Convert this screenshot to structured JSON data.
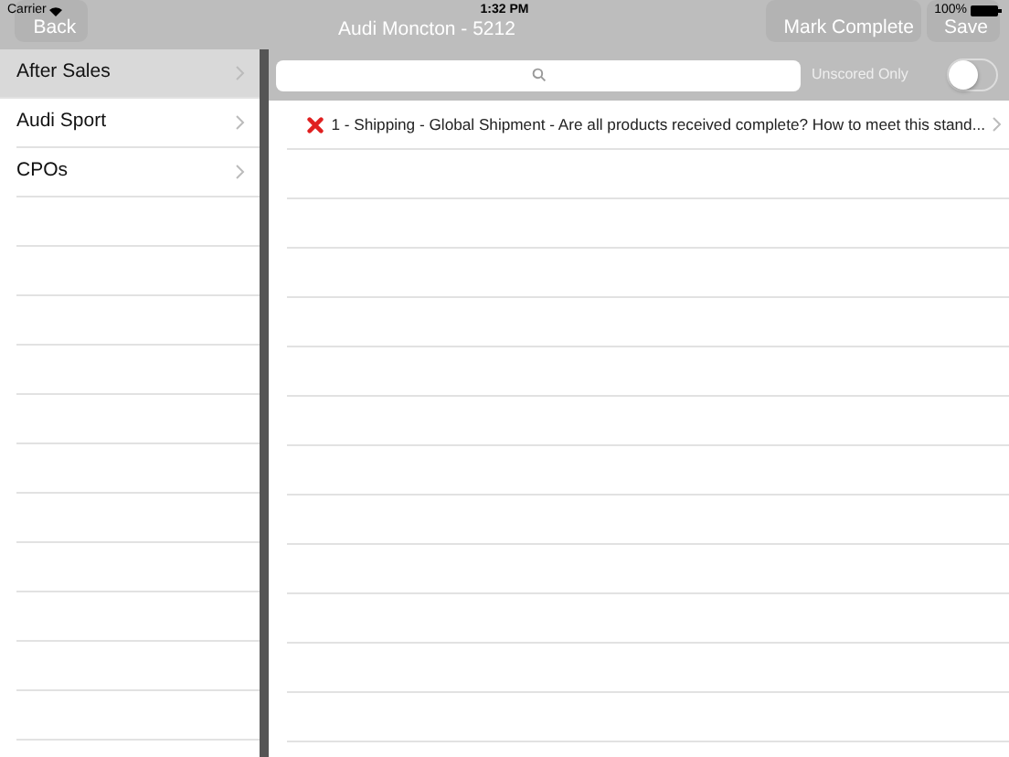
{
  "status_bar": {
    "carrier": "Carrier",
    "time": "1:32 PM",
    "battery": "100%"
  },
  "nav_bar": {
    "back": "Back",
    "title": "Audi Moncton - 5212",
    "buttons": [
      "Mark Complete",
      "Save"
    ]
  },
  "sidebar": {
    "items": [
      {
        "label": "After Sales",
        "selected": true
      },
      {
        "label": "Audi Sport",
        "selected": false
      },
      {
        "label": "CPOs",
        "selected": false
      }
    ]
  },
  "filter": {
    "unscored_only_label": "Unscored Only",
    "unscored_only": false
  },
  "questions": [
    {
      "label": "1 - Shipping - Global Shipment - Are all products received complete? How to meet this stand...",
      "kind": "failed"
    }
  ]
}
